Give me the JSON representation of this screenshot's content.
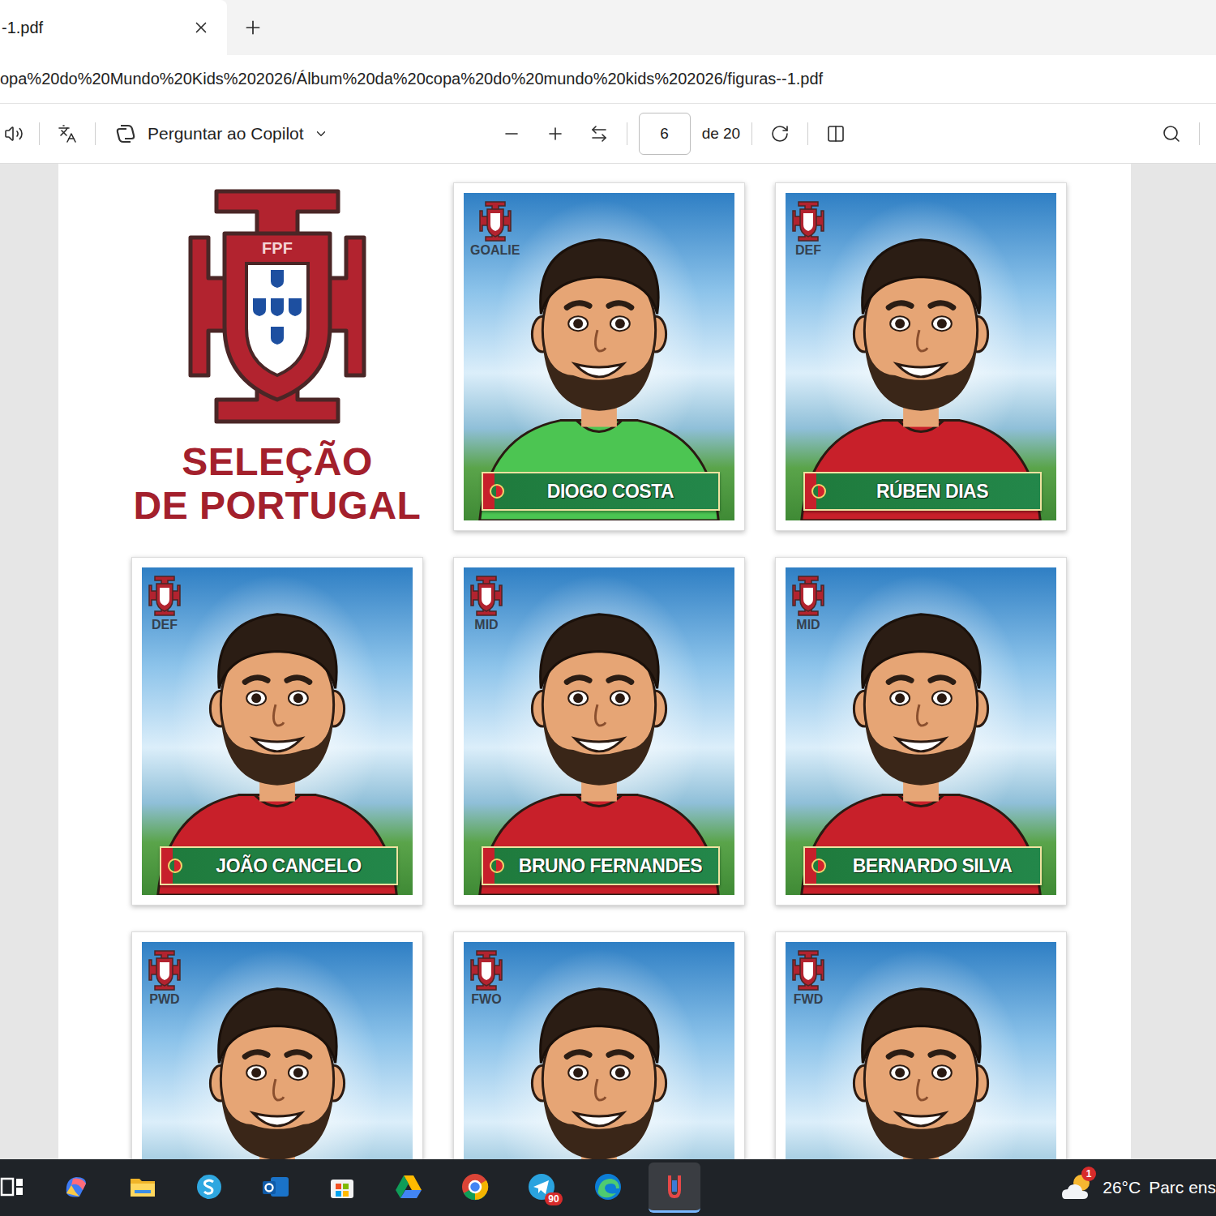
{
  "browser": {
    "tab": {
      "title": "-1.pdf"
    },
    "address": "opa%20do%20Mundo%20Kids%202026/Álbum%20da%20copa%20do%20mundo%20kids%202026/figuras--1.pdf"
  },
  "toolbar": {
    "copilot": "Perguntar ao Copilot",
    "page": "6",
    "page_total": "de 20"
  },
  "document": {
    "crest_text": "FPF",
    "title_lines": [
      "SELEÇÃO",
      "DE PORTUGAL"
    ],
    "cards": [
      {
        "position": "GOALIE",
        "name": "DIOGO COSTA",
        "kind": "goalie"
      },
      {
        "position": "DEF",
        "name": "RÚBEN DIAS",
        "kind": "outfield"
      },
      {
        "position": "DEF",
        "name": "JOÃO CANCELO",
        "kind": "outfield"
      },
      {
        "position": "MID",
        "name": "BRUNO FERNANDES",
        "kind": "outfield"
      },
      {
        "position": "MID",
        "name": "BERNARDO SILVA",
        "kind": "outfield"
      },
      {
        "position": "PWD",
        "name": "",
        "kind": "outfield"
      },
      {
        "position": "FWO",
        "name": "",
        "kind": "outfield"
      },
      {
        "position": "FWD",
        "name": "",
        "kind": "outfield"
      }
    ]
  },
  "taskbar": {
    "apps": [
      {
        "kind": "taskview",
        "selected": false,
        "badge": ""
      },
      {
        "kind": "copilot",
        "selected": false,
        "badge": ""
      },
      {
        "kind": "explorer",
        "selected": false,
        "badge": ""
      },
      {
        "kind": "skype",
        "selected": false,
        "badge": ""
      },
      {
        "kind": "outlook",
        "selected": false,
        "badge": ""
      },
      {
        "kind": "store",
        "selected": false,
        "badge": ""
      },
      {
        "kind": "drive",
        "selected": false,
        "badge": ""
      },
      {
        "kind": "chrome",
        "selected": false,
        "badge": ""
      },
      {
        "kind": "telegram",
        "selected": false,
        "badge": "90"
      },
      {
        "kind": "edge",
        "selected": false,
        "badge": ""
      },
      {
        "kind": "app",
        "selected": true,
        "badge": ""
      }
    ],
    "weather": {
      "badge": "1",
      "temp": "26°C",
      "text": "Parc ens"
    }
  }
}
